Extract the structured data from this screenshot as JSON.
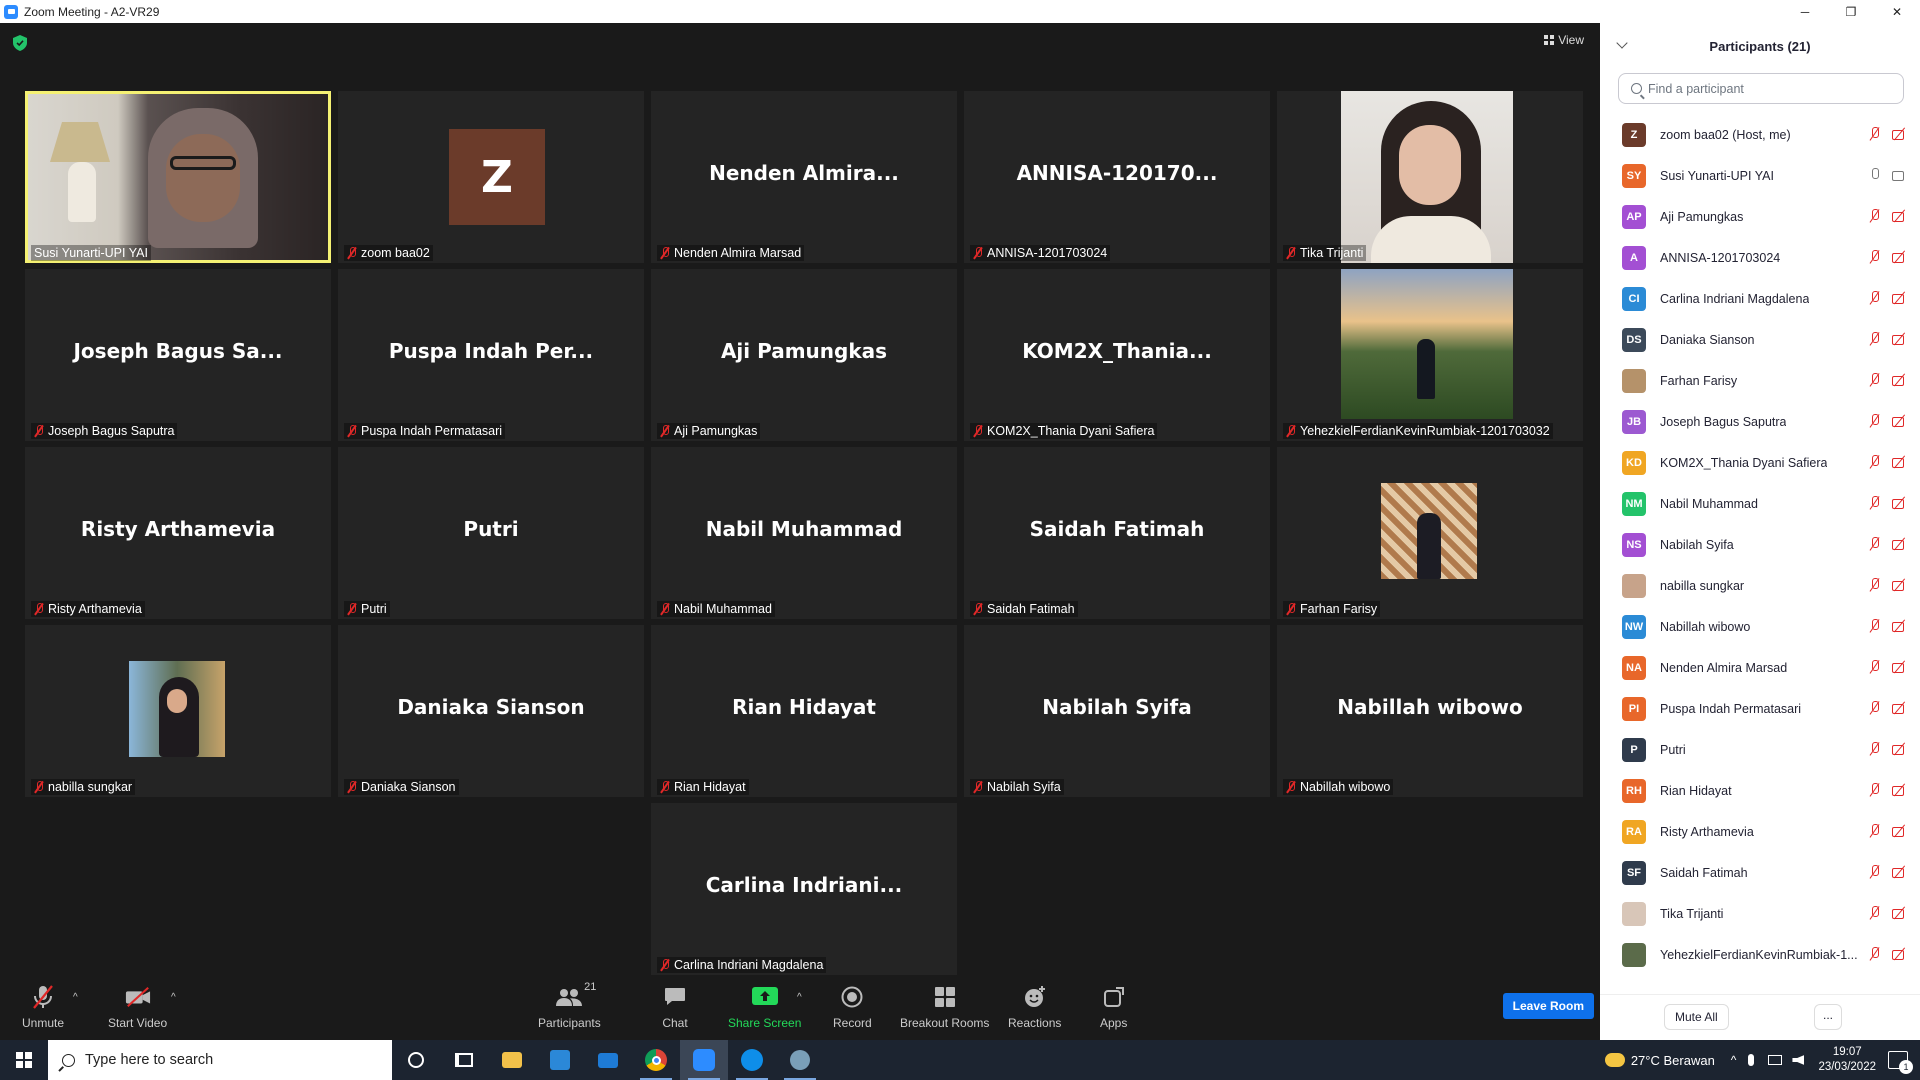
{
  "window": {
    "title": "Zoom Meeting - A2-VR29",
    "minimize": "─",
    "maximize": "❐",
    "close": "✕"
  },
  "meeting": {
    "view_label": "View",
    "tiles": [
      {
        "name": "Susi Yunarti-UPI YAI",
        "big": "",
        "kind": "video-susi",
        "muted": false,
        "active": true
      },
      {
        "name": "zoom baa02",
        "big": "",
        "kind": "avatar-z",
        "avatar_letter": "Z",
        "muted": true
      },
      {
        "name": "Nenden Almira Marsad",
        "big": "Nenden  Almira...",
        "kind": "name",
        "muted": true
      },
      {
        "name": "ANNISA-1201703024",
        "big": "ANNISA-120170...",
        "kind": "name",
        "muted": true
      },
      {
        "name": "Tika Trijanti",
        "big": "",
        "kind": "photo-tika",
        "muted": true
      },
      {
        "name": "Joseph Bagus Saputra",
        "big": "Joseph Bagus Sa...",
        "kind": "name",
        "muted": true
      },
      {
        "name": "Puspa Indah Permatasari",
        "big": "Puspa Indah Per...",
        "kind": "name",
        "muted": true
      },
      {
        "name": "Aji Pamungkas",
        "big": "Aji Pamungkas",
        "kind": "name",
        "muted": true
      },
      {
        "name": "KOM2X_Thania Dyani Safiera",
        "big": "KOM2X_Thania...",
        "kind": "name",
        "muted": true
      },
      {
        "name": "YehezkielFerdianKevinRumbiak-1201703032",
        "big": "",
        "kind": "photo-landscape",
        "muted": true
      },
      {
        "name": "Risty Arthamevia",
        "big": "Risty Arthamevia",
        "kind": "name",
        "muted": true
      },
      {
        "name": "Putri",
        "big": "Putri",
        "kind": "name",
        "muted": true
      },
      {
        "name": "Nabil Muhammad",
        "big": "Nabil Muhammad",
        "kind": "name",
        "muted": true
      },
      {
        "name": "Saidah Fatimah",
        "big": "Saidah Fatimah",
        "kind": "name",
        "muted": true
      },
      {
        "name": "Farhan Farisy",
        "big": "",
        "kind": "photo-farhan",
        "muted": true
      },
      {
        "name": "nabilla sungkar",
        "big": "",
        "kind": "photo-nabilla",
        "muted": true
      },
      {
        "name": "Daniaka Sianson",
        "big": "Daniaka Sianson",
        "kind": "name",
        "muted": true
      },
      {
        "name": "Rian Hidayat",
        "big": "Rian Hidayat",
        "kind": "name",
        "muted": true
      },
      {
        "name": "Nabilah Syifa",
        "big": "Nabilah Syifa",
        "kind": "name",
        "muted": true
      },
      {
        "name": "Nabillah wibowo",
        "big": "Nabillah wibowo",
        "kind": "name",
        "muted": true
      },
      {
        "name": "Carlina Indriani Magdalena",
        "big": "Carlina  Indriani...",
        "kind": "name",
        "muted": true
      }
    ]
  },
  "toolbar": {
    "unmute": "Unmute",
    "start_video": "Start Video",
    "participants": "Participants",
    "participants_count": "21",
    "chat": "Chat",
    "share_screen": "Share Screen",
    "record": "Record",
    "breakout_rooms": "Breakout Rooms",
    "reactions": "Reactions",
    "apps": "Apps",
    "leave_room": "Leave Room"
  },
  "panel": {
    "title": "Participants (21)",
    "search_placeholder": "Find a participant",
    "participants": [
      {
        "initials": "Z",
        "name": "zoom baa02 (Host, me)",
        "color": "#6b3b2a",
        "mic": "off",
        "cam": "off"
      },
      {
        "initials": "SY",
        "name": "Susi Yunarti-UPI YAI",
        "color": "#e8672a",
        "mic": "on",
        "cam": "on"
      },
      {
        "initials": "AP",
        "name": "Aji Pamungkas",
        "color": "#a34fd3",
        "mic": "off",
        "cam": "off"
      },
      {
        "initials": "A",
        "name": "ANNISA-1201703024",
        "color": "#a34fd3",
        "mic": "off",
        "cam": "off"
      },
      {
        "initials": "CI",
        "name": "Carlina Indriani Magdalena",
        "color": "#2b8bd6",
        "mic": "off",
        "cam": "off"
      },
      {
        "initials": "DS",
        "name": "Daniaka Sianson",
        "color": "#3c4a5a",
        "mic": "off",
        "cam": "off"
      },
      {
        "initials": "",
        "name": "Farhan Farisy",
        "color": "#b5926a",
        "mic": "off",
        "cam": "off"
      },
      {
        "initials": "JB",
        "name": "Joseph Bagus Saputra",
        "color": "#9c59d1",
        "mic": "off",
        "cam": "off"
      },
      {
        "initials": "KD",
        "name": "KOM2X_Thania Dyani Safiera",
        "color": "#f0a623",
        "mic": "off",
        "cam": "off"
      },
      {
        "initials": "NM",
        "name": "Nabil Muhammad",
        "color": "#23c36a",
        "mic": "off",
        "cam": "off"
      },
      {
        "initials": "NS",
        "name": "Nabilah Syifa",
        "color": "#a34fd3",
        "mic": "off",
        "cam": "off"
      },
      {
        "initials": "",
        "name": "nabilla sungkar",
        "color": "#c7a38a",
        "mic": "off",
        "cam": "off"
      },
      {
        "initials": "NW",
        "name": "Nabillah wibowo",
        "color": "#2b8bd6",
        "mic": "off",
        "cam": "off"
      },
      {
        "initials": "NA",
        "name": "Nenden Almira Marsad",
        "color": "#e8672a",
        "mic": "off",
        "cam": "off"
      },
      {
        "initials": "PI",
        "name": "Puspa Indah Permatasari",
        "color": "#e8672a",
        "mic": "off",
        "cam": "off"
      },
      {
        "initials": "P",
        "name": "Putri",
        "color": "#2f3b4c",
        "mic": "off",
        "cam": "off"
      },
      {
        "initials": "RH",
        "name": "Rian Hidayat",
        "color": "#e8672a",
        "mic": "off",
        "cam": "off"
      },
      {
        "initials": "RA",
        "name": "Risty Arthamevia",
        "color": "#f0a623",
        "mic": "off",
        "cam": "off"
      },
      {
        "initials": "SF",
        "name": "Saidah Fatimah",
        "color": "#2f3b4c",
        "mic": "off",
        "cam": "off"
      },
      {
        "initials": "",
        "name": "Tika Trijanti",
        "color": "#d8c6b8",
        "mic": "off",
        "cam": "off"
      },
      {
        "initials": "",
        "name": "YehezkielFerdianKevinRumbiak-1...",
        "color": "#5b6b4a",
        "mic": "off",
        "cam": "off"
      }
    ],
    "mute_all": "Mute All",
    "more": "..."
  },
  "taskbar": {
    "search_placeholder": "Type here to search",
    "weather": "27°C  Berawan",
    "time": "19:07",
    "date": "23/03/2022",
    "notification_count": "1"
  }
}
